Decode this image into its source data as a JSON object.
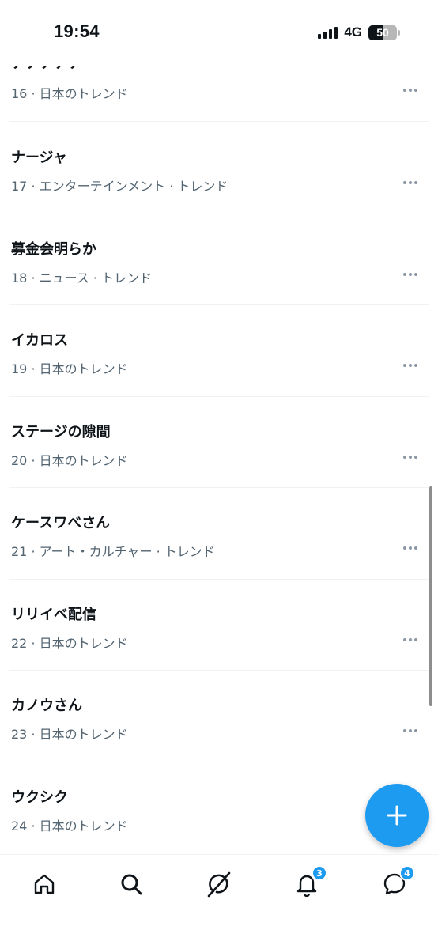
{
  "status_bar": {
    "time": "19:54",
    "network": "4G",
    "battery_level": "50"
  },
  "partial_trend": {
    "name": "ナナナナナ",
    "meta": "16 · 日本のトレンド"
  },
  "trends": [
    {
      "name": "ナージャ",
      "meta": "17 · エンターテインメント · トレンド"
    },
    {
      "name": "募金会明らか",
      "meta": "18 · ニュース · トレンド"
    },
    {
      "name": "イカロス",
      "meta": "19 · 日本のトレンド"
    },
    {
      "name": "ステージの隙間",
      "meta": "20 · 日本のトレンド"
    },
    {
      "name": "ケースワべさん",
      "meta": "21 · アート・カルチャー · トレンド"
    },
    {
      "name": "リリイベ配信",
      "meta": "22 · 日本のトレンド"
    },
    {
      "name": "カノウさん",
      "meta": "23 · 日本のトレンド"
    },
    {
      "name": "ウクシク",
      "meta": "24 · 日本のトレンド"
    }
  ],
  "icons": {
    "more": "more-horizontal-icon",
    "compose": "plus-icon",
    "home": "home-icon",
    "search": "search-icon",
    "grok": "grok-icon",
    "notifications": "bell-icon",
    "messages": "message-icon"
  },
  "bottom_nav": {
    "notifications_badge": "3",
    "messages_badge": "4"
  },
  "colors": {
    "accent": "#1d9bf0",
    "text_primary": "#0f1419",
    "text_secondary": "#536471",
    "divider": "#eff3f4"
  }
}
